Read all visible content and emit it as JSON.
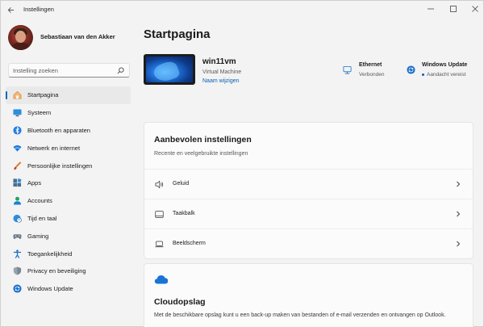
{
  "window": {
    "title": "Instellingen",
    "controls": {
      "minimize": "—",
      "maximize": "☐",
      "close": "✕"
    }
  },
  "profile": {
    "name": "Sebastiaan van den Akker"
  },
  "search": {
    "placeholder": "Instelling zoeken"
  },
  "sidebar": {
    "items": [
      {
        "label": "Startpagina",
        "icon": "home-icon",
        "active": true
      },
      {
        "label": "Systeem",
        "icon": "monitor-icon"
      },
      {
        "label": "Bluetooth en apparaten",
        "icon": "bluetooth-icon"
      },
      {
        "label": "Netwerk en internet",
        "icon": "wifi-icon"
      },
      {
        "label": "Persoonlijke instellingen",
        "icon": "brush-icon"
      },
      {
        "label": "Apps",
        "icon": "apps-icon"
      },
      {
        "label": "Accounts",
        "icon": "person-icon"
      },
      {
        "label": "Tijd en taal",
        "icon": "globe-clock-icon"
      },
      {
        "label": "Gaming",
        "icon": "gamepad-icon"
      },
      {
        "label": "Toegankelijkheid",
        "icon": "accessibility-icon"
      },
      {
        "label": "Privacy en beveiliging",
        "icon": "shield-icon"
      },
      {
        "label": "Windows Update",
        "icon": "update-icon"
      }
    ]
  },
  "main": {
    "title": "Startpagina",
    "device": {
      "name": "win11vm",
      "type": "Virtual Machine",
      "rename_link": "Naam wijzigen"
    },
    "status": {
      "ethernet": {
        "title": "Ethernet",
        "status": "Verbonden"
      },
      "update": {
        "title": "Windows Update",
        "status": "Aandacht vereist"
      }
    },
    "recommended": {
      "title": "Aanbevolen instellingen",
      "subtitle": "Recente en veelgebruikte instellingen",
      "rows": [
        {
          "label": "Geluid",
          "icon": "speaker-icon"
        },
        {
          "label": "Taakbalk",
          "icon": "taskbar-icon"
        },
        {
          "label": "Beeldscherm",
          "icon": "laptop-icon"
        }
      ]
    },
    "cloud": {
      "title": "Cloudopslag",
      "description": "Met de beschikbare opslag kunt u een back-up maken van bestanden of e-mail verzenden en ontvangen op Outlook."
    }
  },
  "colors": {
    "accent": "#0067c0",
    "link": "#0a5fb4",
    "background": "#f3f3f3",
    "card": "#fbfbfb"
  }
}
